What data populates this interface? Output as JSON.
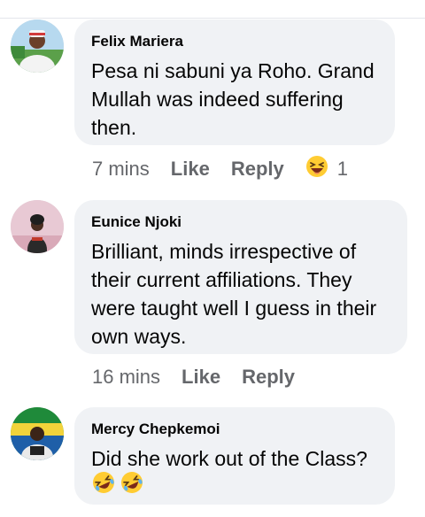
{
  "comments": [
    {
      "author": "Felix Mariera",
      "lines": [
        "Pesa ni sabuni ya Roho. Grand",
        "Mullah was indeed suffering",
        "then."
      ],
      "time": "7 mins",
      "like_label": "Like",
      "reply_label": "Reply",
      "reaction": "laughing-squint-emoji",
      "reaction_count": "1"
    },
    {
      "author": "Eunice Njoki",
      "lines": [
        "Brilliant, minds irrespective of",
        "their current affiliations.  They",
        "were taught well I guess in their",
        "own ways."
      ],
      "time": "16 mins",
      "like_label": "Like",
      "reply_label": "Reply"
    },
    {
      "author": "Mercy Chepkemoi",
      "lines": [
        "Did she work out of the Class?"
      ],
      "emojis": [
        "rolling-laughing-emoji",
        "rolling-laughing-emoji"
      ]
    }
  ],
  "colors": {
    "bubble": "#f0f2f5",
    "text": "#050505",
    "meta": "#65676b",
    "emoji_yellow": "#ffcc33"
  }
}
